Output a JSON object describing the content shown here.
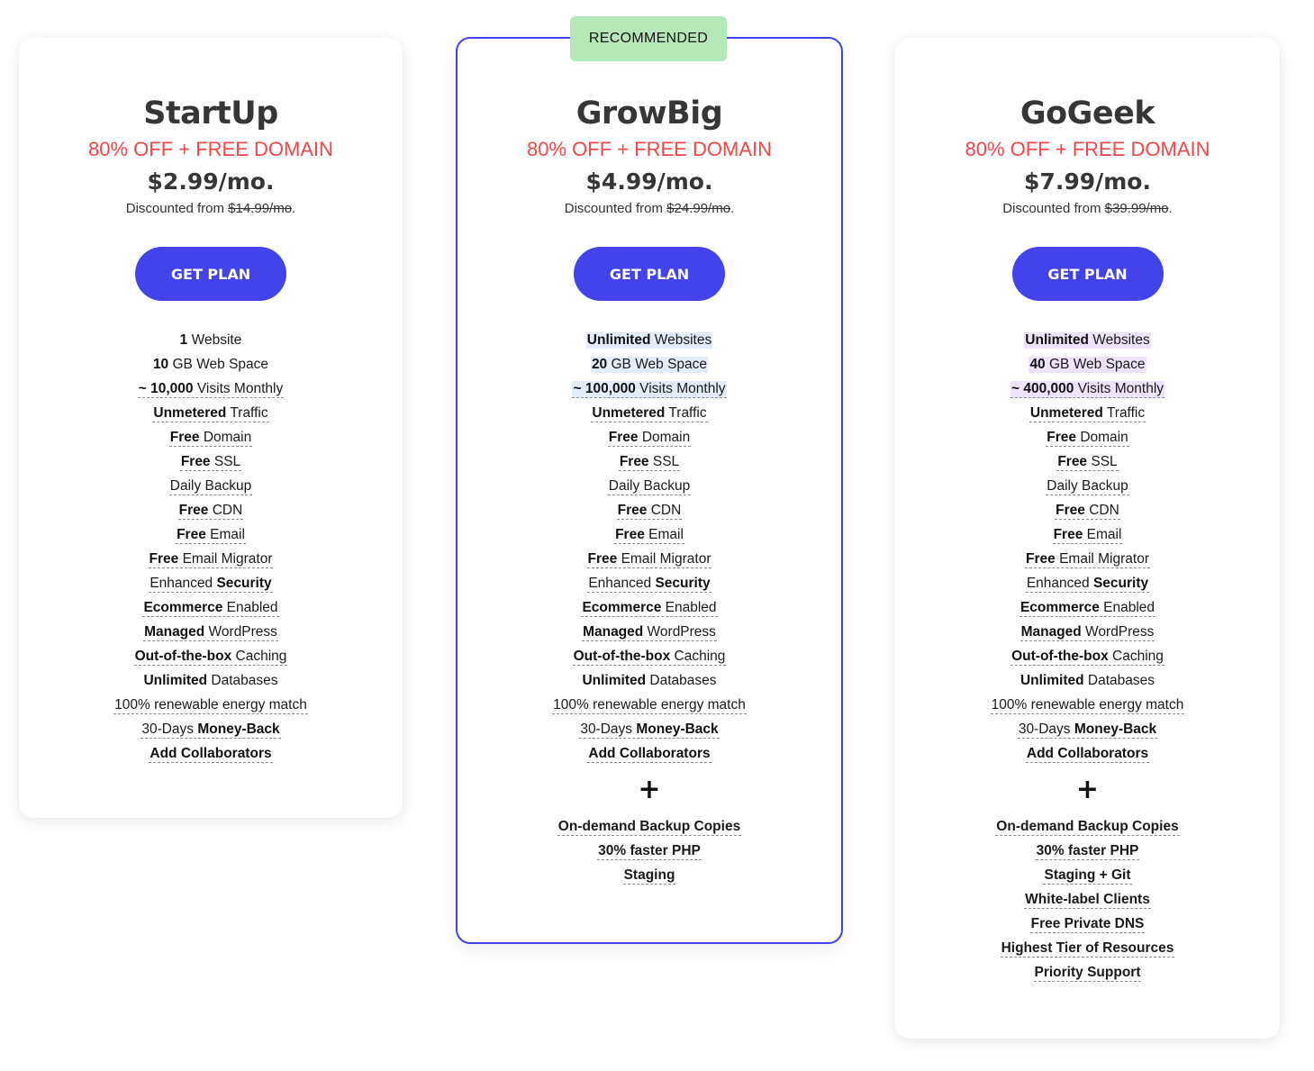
{
  "badge": {
    "label": "RECOMMENDED",
    "color": "#b5e8b8"
  },
  "colors": {
    "accent": "#4343ec",
    "promo": "#f04848"
  },
  "plans": [
    {
      "name": "StartUp",
      "promo": "80% OFF + FREE DOMAIN",
      "price": "$2.99/mo.",
      "discount_prefix": "Discounted from ",
      "original_price": "$14.99/mo",
      "discount_suffix": ".",
      "cta": "GET PLAN",
      "features": [
        {
          "bold": "1",
          "text": " Website"
        },
        {
          "bold": "10",
          "text": " GB Web Space"
        },
        {
          "bold": "~ 10,000",
          "text": " Visits Monthly"
        },
        {
          "bold": "Unmetered",
          "text": " Traffic"
        },
        {
          "bold": "Free",
          "text": " Domain"
        },
        {
          "bold": "Free",
          "text": " SSL"
        },
        {
          "bold": "",
          "text": "Daily Backup"
        },
        {
          "bold": "Free",
          "text": " CDN"
        },
        {
          "bold": "Free",
          "text": " Email"
        },
        {
          "bold": "Free",
          "text": " Email Migrator"
        },
        {
          "pre": "Enhanced ",
          "bold": "Security",
          "text": ""
        },
        {
          "bold": "Ecommerce",
          "text": " Enabled"
        },
        {
          "bold": "Managed",
          "text": " WordPress"
        },
        {
          "bold": "Out-of-the-box",
          "text": " Caching"
        },
        {
          "bold": "Unlimited",
          "text": " Databases"
        },
        {
          "bold": "",
          "text": "100% renewable energy match"
        },
        {
          "pre": "30-Days ",
          "bold": "Money-Back",
          "text": ""
        },
        {
          "bold": "Add Collaborators",
          "text": ""
        }
      ],
      "extras": []
    },
    {
      "name": "GrowBig",
      "promo": "80% OFF + FREE DOMAIN",
      "price": "$4.99/mo.",
      "discount_prefix": "Discounted from ",
      "original_price": "$24.99/mo",
      "discount_suffix": ".",
      "cta": "GET PLAN",
      "features": [
        {
          "bold": "Unlimited",
          "text": " Websites"
        },
        {
          "bold": "20",
          "text": " GB Web Space"
        },
        {
          "bold": "~ 100,000",
          "text": " Visits Monthly"
        },
        {
          "bold": "Unmetered",
          "text": " Traffic"
        },
        {
          "bold": "Free",
          "text": " Domain"
        },
        {
          "bold": "Free",
          "text": " SSL"
        },
        {
          "bold": "",
          "text": "Daily Backup"
        },
        {
          "bold": "Free",
          "text": " CDN"
        },
        {
          "bold": "Free",
          "text": " Email"
        },
        {
          "bold": "Free",
          "text": " Email Migrator"
        },
        {
          "pre": "Enhanced ",
          "bold": "Security",
          "text": ""
        },
        {
          "bold": "Ecommerce",
          "text": " Enabled"
        },
        {
          "bold": "Managed",
          "text": " WordPress"
        },
        {
          "bold": "Out-of-the-box",
          "text": " Caching"
        },
        {
          "bold": "Unlimited",
          "text": " Databases"
        },
        {
          "bold": "",
          "text": "100% renewable energy match"
        },
        {
          "pre": "30-Days ",
          "bold": "Money-Back",
          "text": ""
        },
        {
          "bold": "Add Collaborators",
          "text": ""
        }
      ],
      "plus": "+",
      "extras": [
        "On-demand Backup Copies",
        "30% faster PHP",
        "Staging"
      ]
    },
    {
      "name": "GoGeek",
      "promo": "80% OFF + FREE DOMAIN",
      "price": "$7.99/mo.",
      "discount_prefix": "Discounted from ",
      "original_price": "$39.99/mo",
      "discount_suffix": ".",
      "cta": "GET PLAN",
      "features": [
        {
          "bold": "Unlimited",
          "text": " Websites"
        },
        {
          "bold": "40",
          "text": " GB Web Space"
        },
        {
          "bold": "~ 400,000",
          "text": " Visits Monthly"
        },
        {
          "bold": "Unmetered",
          "text": " Traffic"
        },
        {
          "bold": "Free",
          "text": " Domain"
        },
        {
          "bold": "Free",
          "text": " SSL"
        },
        {
          "bold": "",
          "text": "Daily Backup"
        },
        {
          "bold": "Free",
          "text": " CDN"
        },
        {
          "bold": "Free",
          "text": " Email"
        },
        {
          "bold": "Free",
          "text": " Email Migrator"
        },
        {
          "pre": "Enhanced ",
          "bold": "Security",
          "text": ""
        },
        {
          "bold": "Ecommerce",
          "text": " Enabled"
        },
        {
          "bold": "Managed",
          "text": " WordPress"
        },
        {
          "bold": "Out-of-the-box",
          "text": " Caching"
        },
        {
          "bold": "Unlimited",
          "text": " Databases"
        },
        {
          "bold": "",
          "text": "100% renewable energy match"
        },
        {
          "pre": "30-Days ",
          "bold": "Money-Back",
          "text": ""
        },
        {
          "bold": "Add Collaborators",
          "text": ""
        }
      ],
      "plus": "+",
      "extras": [
        "On-demand Backup Copies",
        "30% faster PHP",
        "Staging + Git",
        "White-label Clients",
        "Free Private DNS",
        "Highest Tier of Resources",
        "Priority Support"
      ]
    }
  ]
}
